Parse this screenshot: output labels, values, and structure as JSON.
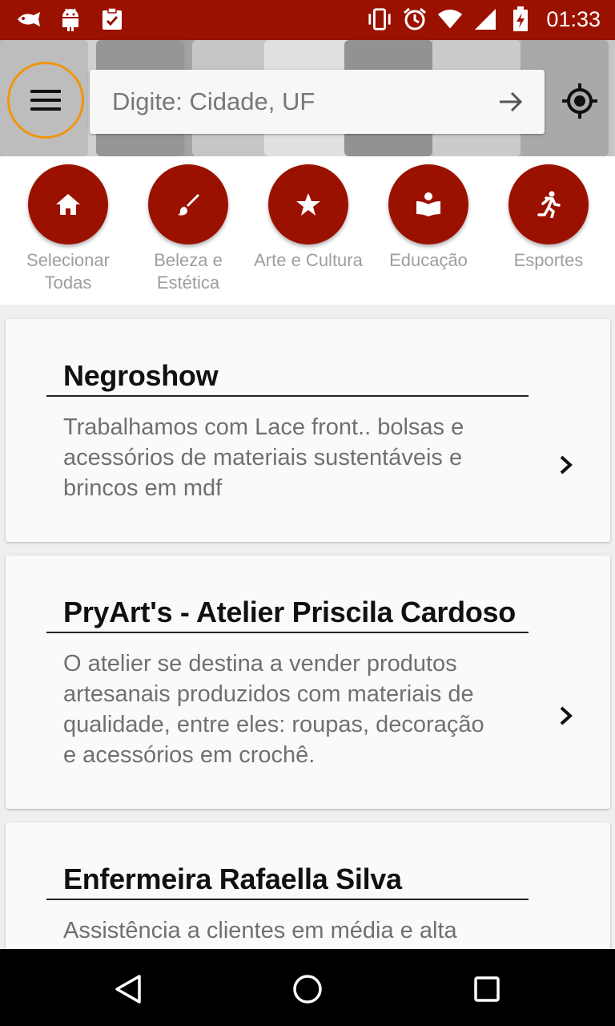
{
  "status_bar": {
    "time": "01:33",
    "left_icons": [
      "fish-icon",
      "android-icon",
      "clipboard-check-icon"
    ],
    "right_icons": [
      "vibrate-icon",
      "alarm-icon",
      "wifi-icon",
      "signal-icon",
      "battery-charging-icon"
    ]
  },
  "search": {
    "placeholder": "Digite: Cidade, UF",
    "value": ""
  },
  "categories": [
    {
      "label": "Selecionar Todas",
      "icon": "home-icon"
    },
    {
      "label": "Beleza e Estética",
      "icon": "brush-icon"
    },
    {
      "label": "Arte e Cultura",
      "icon": "star-icon"
    },
    {
      "label": "Educação",
      "icon": "book-reader-icon"
    },
    {
      "label": "Esportes",
      "icon": "runner-icon"
    }
  ],
  "listings": [
    {
      "title": "Negroshow",
      "description": "Trabalhamos com Lace front.. bolsas e acessórios de materiais sustentáveis e brincos em mdf"
    },
    {
      "title": "PryArt's - Atelier Priscila Cardoso",
      "description": "O atelier se destina a vender produtos artesanais produzidos com materiais de qualidade, entre eles: roupas, decoração e acessórios em crochê."
    },
    {
      "title": "Enfermeira Rafaella Silva",
      "description": "Assistência a clientes em média e alta"
    }
  ],
  "colors": {
    "brand": "#9b1100",
    "menu_highlight": "#f0950e",
    "muted_text": "#9e9e9e"
  }
}
